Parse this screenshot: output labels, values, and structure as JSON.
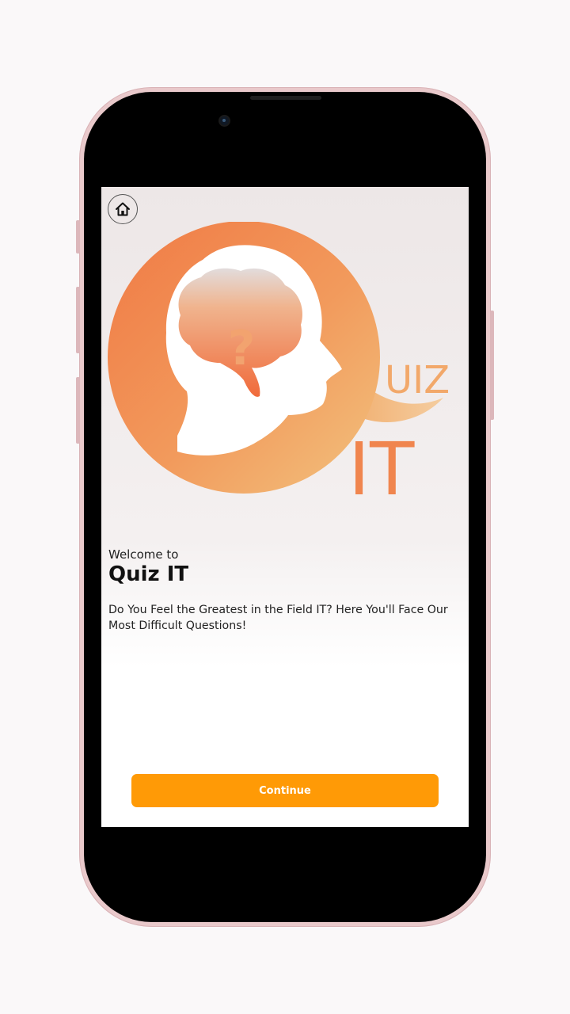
{
  "logo": {
    "text_uiz": "UIZ",
    "text_it": "IT",
    "question_mark": "?"
  },
  "home": {
    "icon": "home-icon"
  },
  "welcome": {
    "subtitle": "Welcome to",
    "title": "Quiz IT",
    "description": "Do You Feel the Greatest in the Field IT? Here You'll Face Our Most Difficult Questions!"
  },
  "actions": {
    "continue_label": "Continue"
  },
  "colors": {
    "accent": "#ff9a06",
    "logo_orange": "#f0834a",
    "logo_light": "#f2b877",
    "phone_frame": "#e9c9cb"
  }
}
